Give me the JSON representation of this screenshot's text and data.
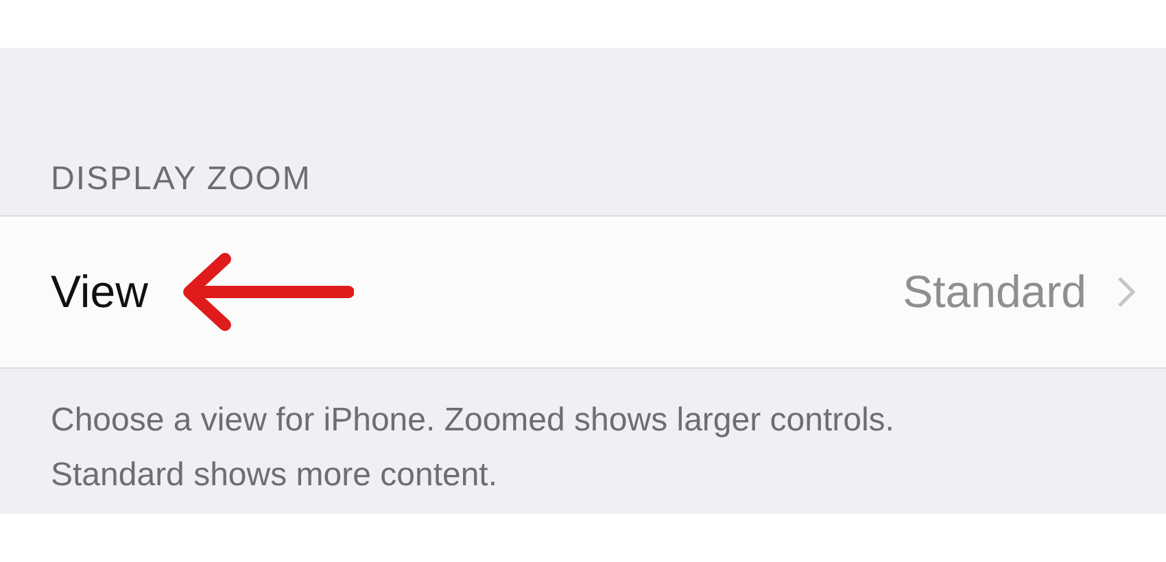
{
  "section": {
    "header": "DISPLAY ZOOM",
    "rows": [
      {
        "label": "View",
        "value": "Standard",
        "annotated": true
      }
    ],
    "footer": "Choose a view for iPhone. Zoomed shows larger controls. Standard shows more content."
  }
}
